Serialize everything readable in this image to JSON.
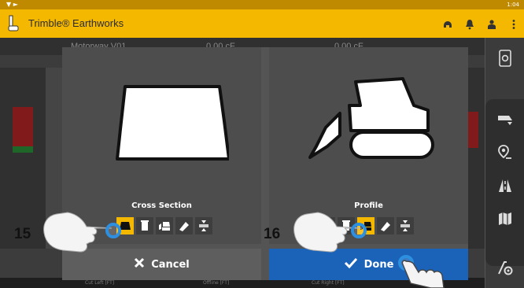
{
  "status_bar": {
    "time": "1:04"
  },
  "app_bar": {
    "title": "Trimble® Earthworks",
    "icons": [
      "headset-icon",
      "bell-icon",
      "operator-icon",
      "overflow-menu-icon"
    ]
  },
  "background": {
    "top_left_text": "Motorway V01",
    "top_value_1": "0.00 cF",
    "top_value_2": "0.00 cF",
    "bottom_labels": [
      "Cut Left [FT]",
      "Offline [FT]",
      "Cut Right [FT]"
    ]
  },
  "sidebar": {
    "icons": [
      "settings-phone-icon",
      "truck-dump-icon",
      "location-pin-icon",
      "road-icon",
      "map-icon",
      "machine-settings-icon"
    ]
  },
  "dialog": {
    "left_panel": {
      "title": "Cross Section",
      "options": [
        "blade-icon",
        "bucket-front-icon",
        "dozer-side-icon",
        "tilt-icon",
        "compress-icon"
      ],
      "selected_index": 0
    },
    "right_panel": {
      "title": "Profile",
      "options": [
        "blade-icon",
        "bucket-front-icon",
        "dozer-side-icon",
        "tilt-icon",
        "compress-icon"
      ],
      "selected_index": 2
    },
    "cancel_label": "Cancel",
    "done_label": "Done"
  },
  "callouts": [
    "15",
    "16"
  ],
  "colors": {
    "accent": "#f5b800",
    "primary_button": "#1a63b8",
    "touch": "#2d8fe0"
  }
}
